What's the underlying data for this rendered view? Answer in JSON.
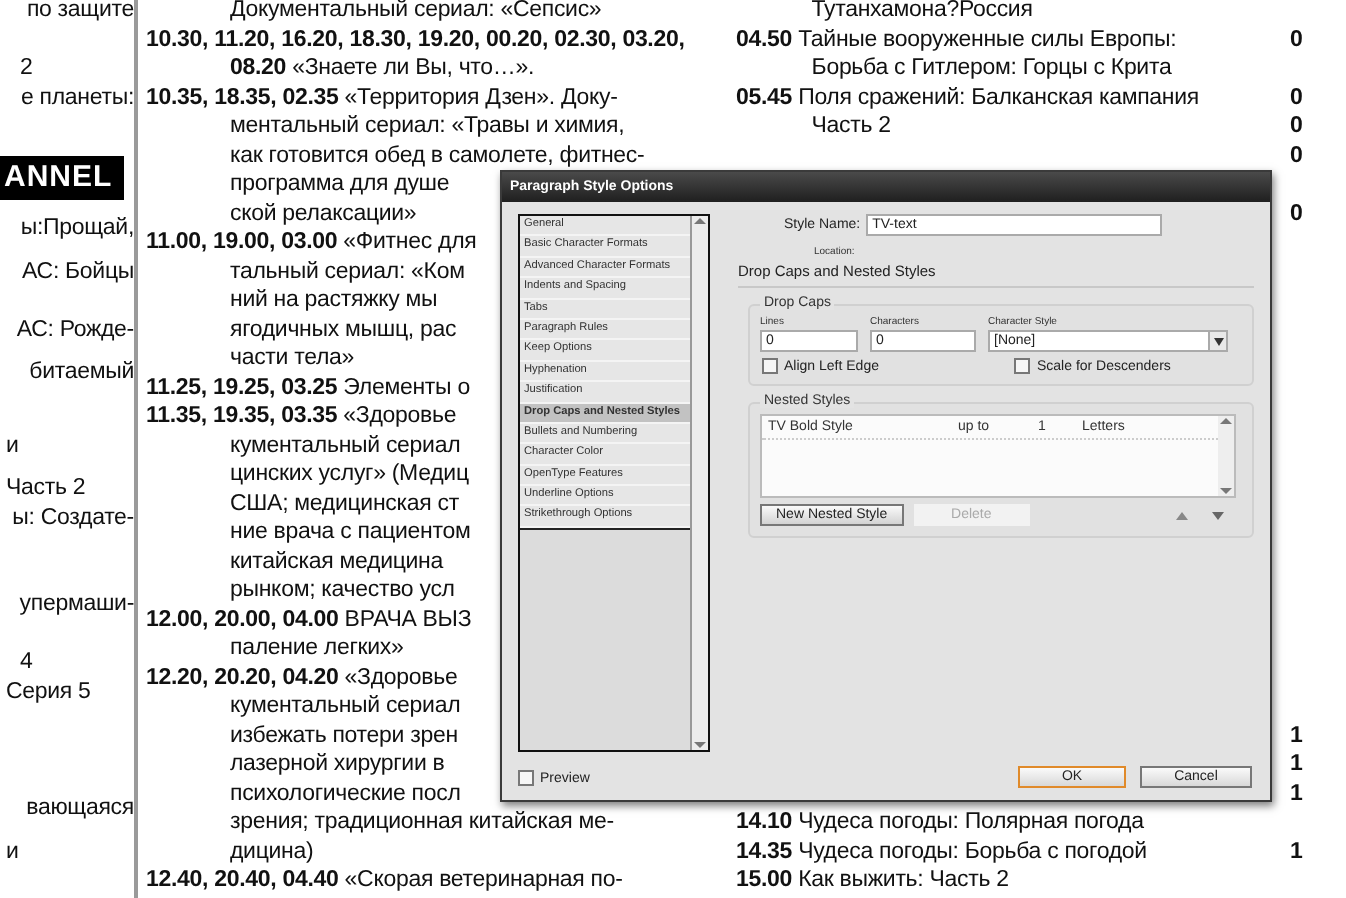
{
  "left_column": {
    "lines": [
      {
        "kind": "text",
        "text": "по защите"
      },
      {
        "kind": "text",
        "text": "2"
      },
      {
        "kind": "text",
        "text": "е планеты:"
      },
      {
        "kind": "banner",
        "text": "ANNEL"
      },
      {
        "kind": "text",
        "text": "ы:Прощай,"
      },
      {
        "kind": "text",
        "text": "АС: Бойцы"
      },
      {
        "kind": "text",
        "text": "АС: Рожде-"
      },
      {
        "kind": "text",
        "text": "битаемый"
      },
      {
        "kind": "text",
        "text": "и"
      },
      {
        "kind": "text",
        "text": "Часть 2"
      },
      {
        "kind": "text",
        "text": "ы: Создате-"
      },
      {
        "kind": "text",
        "text": "упермаши-"
      },
      {
        "kind": "text",
        "text": "4"
      },
      {
        "kind": "text",
        "text": "Серия 5"
      },
      {
        "kind": "text",
        "text": "вающаяся"
      },
      {
        "kind": "text",
        "text": "и"
      }
    ]
  },
  "middle_column": {
    "lines": [
      {
        "kind": "continuation",
        "text": "Документальный сериал: «Сепсис»"
      },
      {
        "kind": "entry",
        "text": "**10.30, 11.20, 16.20, 18.30, 19.20, 00.20, 02.30, 03.20,**"
      },
      {
        "kind": "continuation",
        "text": "**08.20** «Знаете ли Вы, что…»."
      },
      {
        "kind": "entry",
        "text": "**10.35, 18.35, 02.35** «Территория Дзен». Доку-"
      },
      {
        "kind": "continuation",
        "text": "ментальный сериал: «Травы и химия,"
      },
      {
        "kind": "continuation",
        "text": "как готовится обед в самолете, фитнес-"
      },
      {
        "kind": "continuation",
        "text": "программа для душе"
      },
      {
        "kind": "continuation",
        "text": "ской релаксации»"
      },
      {
        "kind": "entry",
        "text": "**11.00, 19.00, 03.00** «Фитнес для"
      },
      {
        "kind": "continuation",
        "text": "тальный сериал: «Ком"
      },
      {
        "kind": "continuation",
        "text": "ний на растяжку мы"
      },
      {
        "kind": "continuation",
        "text": "ягодичных мышц, рас"
      },
      {
        "kind": "continuation",
        "text": "части тела»"
      },
      {
        "kind": "entry",
        "text": "**11.25, 19.25, 03.25** Элементы о"
      },
      {
        "kind": "entry",
        "text": "**11.35, 19.35, 03.35** «Здоровье"
      },
      {
        "kind": "continuation",
        "text": "кументальный сериал"
      },
      {
        "kind": "continuation",
        "text": "цинских услуг» (Медиц"
      },
      {
        "kind": "continuation",
        "text": "США; медицинская ст"
      },
      {
        "kind": "continuation",
        "text": "ние врача с пациентом"
      },
      {
        "kind": "continuation",
        "text": "китайская медицина"
      },
      {
        "kind": "continuation",
        "text": "рынком; качество усл"
      },
      {
        "kind": "entry",
        "text": "**12.00, 20.00, 04.00** ВРАЧА ВЫЗ"
      },
      {
        "kind": "continuation",
        "text": "паление легких»"
      },
      {
        "kind": "entry",
        "text": "**12.20, 20.20, 04.20** «Здоровье"
      },
      {
        "kind": "continuation",
        "text": "кументальный сериал"
      },
      {
        "kind": "continuation",
        "text": "избежать потери зрен"
      },
      {
        "kind": "continuation",
        "text": "лазерной хирургии в"
      },
      {
        "kind": "continuation",
        "text": "психологические посл"
      },
      {
        "kind": "continuation",
        "text": "зрения; традиционная китайская ме-"
      },
      {
        "kind": "continuation",
        "text": "дицина)"
      },
      {
        "kind": "entry",
        "text": "**12.40, 20.40, 04.40** «Скорая ветеринарная по-"
      }
    ]
  },
  "right_column": {
    "top_lines": [
      {
        "kind": "continuation",
        "text": "Тутанхамона?Россия"
      },
      {
        "kind": "entry",
        "text": "**04.50** Тайные вооруженные силы Европы:"
      },
      {
        "kind": "continuation",
        "text": "Борьба с Гитлером: Горцы с Крита"
      },
      {
        "kind": "entry",
        "text": "**05.45** Поля сражений: Балканская кампания"
      },
      {
        "kind": "continuation",
        "text": "Часть 2"
      }
    ],
    "bottom_lines": [
      {
        "kind": "entry",
        "text": "**14.10** Чудеса погоды: Полярная погода"
      },
      {
        "kind": "entry",
        "text": "**14.35** Чудеса погоды: Борьба с погодой"
      },
      {
        "kind": "entry",
        "text": "**15.00** Как выжить: Часть 2"
      }
    ]
  },
  "far_right_column": {
    "fragments": [
      "0",
      "0",
      "0",
      "0",
      "0",
      "1",
      "1",
      "1",
      "1"
    ]
  },
  "dialog": {
    "title": "Paragraph Style Options",
    "categories": [
      {
        "label": "General",
        "selected": false
      },
      {
        "label": "Basic Character Formats",
        "selected": false
      },
      {
        "label": "Advanced Character Formats",
        "selected": false
      },
      {
        "label": "Indents and Spacing",
        "selected": false
      },
      {
        "label": "Tabs",
        "selected": false
      },
      {
        "label": "Paragraph Rules",
        "selected": false
      },
      {
        "label": "Keep Options",
        "selected": false
      },
      {
        "label": "Hyphenation",
        "selected": false
      },
      {
        "label": "Justification",
        "selected": false
      },
      {
        "label": "Drop Caps and Nested Styles",
        "selected": true
      },
      {
        "label": "Bullets and Numbering",
        "selected": false
      },
      {
        "label": "Character Color",
        "selected": false
      },
      {
        "label": "OpenType Features",
        "selected": false
      },
      {
        "label": "Underline Options",
        "selected": false
      },
      {
        "label": "Strikethrough Options",
        "selected": false
      }
    ],
    "preview": {
      "label": "Preview",
      "checked": false
    },
    "style_name": {
      "label": "Style Name:",
      "value": "TV-text"
    },
    "location_label": "Location:",
    "section_title": "Drop Caps and Nested Styles",
    "drop_caps": {
      "title": "Drop Caps",
      "lines": {
        "label": "Lines",
        "value": "0"
      },
      "characters": {
        "label": "Characters",
        "value": "0"
      },
      "character_style": {
        "label": "Character Style",
        "value": "[None]"
      },
      "align_left_edge": {
        "label": "Align Left Edge",
        "checked": false
      },
      "scale_for_descenders": {
        "label": "Scale for Descenders",
        "checked": false
      }
    },
    "nested_styles": {
      "title": "Nested Styles",
      "rows": [
        {
          "style": "TV Bold Style",
          "mode": "up to",
          "count": "1",
          "unit": "Letters"
        }
      ],
      "buttons": [
        {
          "label": "New Nested Style",
          "disabled": false
        },
        {
          "label": "Delete",
          "disabled": true
        }
      ]
    },
    "buttons": [
      {
        "label": "OK",
        "default": true
      },
      {
        "label": "Cancel",
        "default": false
      }
    ]
  }
}
